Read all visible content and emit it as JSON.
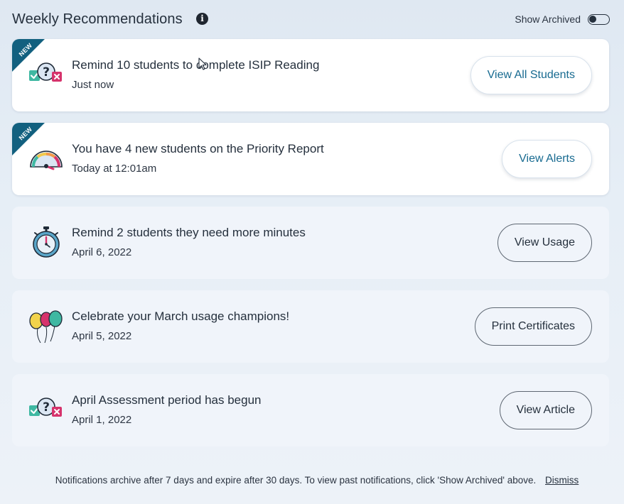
{
  "header": {
    "title": "Weekly Recommendations",
    "info_icon": "i",
    "show_archived_label": "Show Archived",
    "show_archived_on": false
  },
  "badge_label": "NEW",
  "cards": [
    {
      "icon": "quiz-check-x-icon",
      "title": "Remind 10 students to complete ISIP Reading",
      "time": "Just now",
      "button": "View All Students",
      "is_new": true
    },
    {
      "icon": "speedometer-icon",
      "title": "You have 4 new students on the Priority Report",
      "time": "Today at 12:01am",
      "button": "View Alerts",
      "is_new": true
    },
    {
      "icon": "stopwatch-icon",
      "title": "Remind 2 students they need more minutes",
      "time": "April 6, 2022",
      "button": "View Usage",
      "is_new": false
    },
    {
      "icon": "balloons-icon",
      "title": "Celebrate your March usage champions!",
      "time": "April 5, 2022",
      "button": "Print Certificates",
      "is_new": false
    },
    {
      "icon": "quiz-check-x-icon",
      "title": "April Assessment period has begun",
      "time": "April 1, 2022",
      "button": "View Article",
      "is_new": false
    }
  ],
  "footer": {
    "note": "Notifications archive after 7 days and expire after 30 days. To view past notifications, click 'Show Archived' above.",
    "dismiss_label": "Dismiss"
  },
  "colors": {
    "accent": "#176a90",
    "badge": "#12607f",
    "text": "#25303d",
    "check": "#3fb8a2",
    "cross": "#d6336c"
  }
}
